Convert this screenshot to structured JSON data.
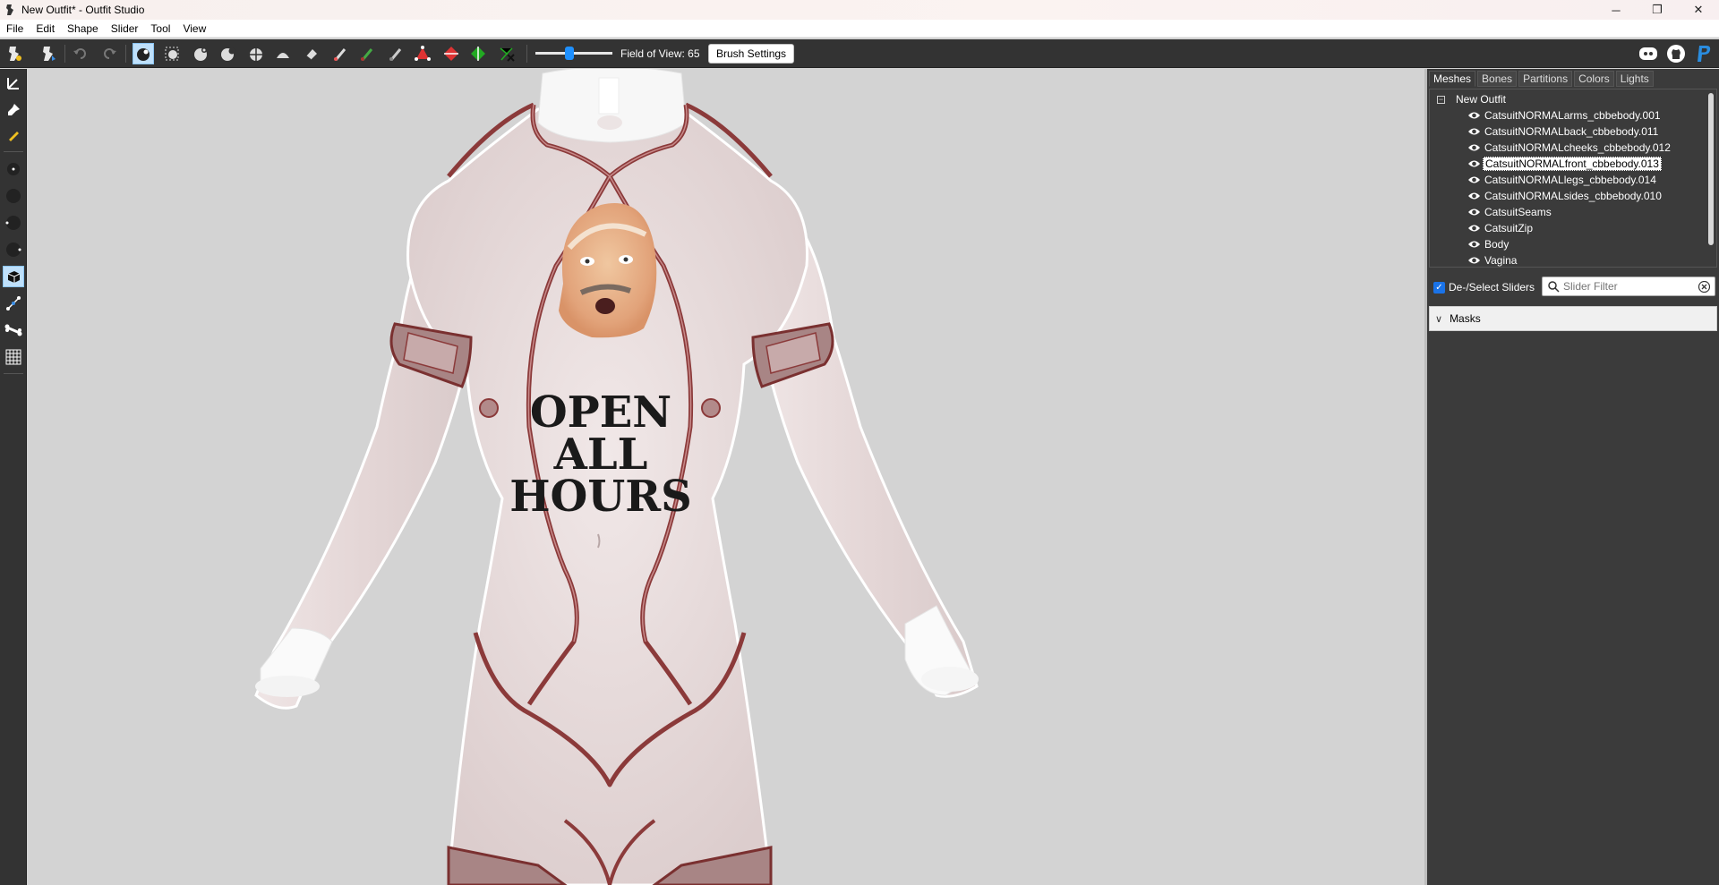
{
  "window": {
    "title": "New Outfit* - Outfit Studio",
    "minimize_glyph": "─",
    "restore_glyph": "❐",
    "close_glyph": "✕"
  },
  "menu": [
    "File",
    "Edit",
    "Shape",
    "Slider",
    "Tool",
    "View"
  ],
  "toolbar": {
    "field_of_view_label": "Field of View: 65",
    "field_of_view_value": 65,
    "brush_settings_label": "Brush Settings",
    "icons": [
      "load-project-icon",
      "save-project-icon",
      "undo-icon",
      "redo-icon",
      "select-brush-icon",
      "mask-brush-icon",
      "inflate-brush-icon",
      "deflate-brush-icon",
      "move-brush-icon",
      "smooth-brush-icon",
      "undiff-brush-icon",
      "weight-brush-icon",
      "color-brush-icon",
      "alpha-brush-icon",
      "collapse-vertex-icon",
      "flip-edge-icon",
      "split-edge-icon",
      "delete-vertex-icon"
    ],
    "right_icons": [
      "discord-icon",
      "github-icon",
      "paypal-icon"
    ]
  },
  "left_tools": [
    "transform-tool-icon",
    "pivot-tool-icon",
    "pen-tool-icon",
    "small-brush-icon",
    "medium-brush-icon",
    "large-brush-icon",
    "xl-brush-icon",
    "vertex-select-icon",
    "edge-tool-icon",
    "bone-tool-icon",
    "grid-icon"
  ],
  "viewport": {
    "shirt_text_lines": [
      "OPEN",
      "ALL",
      "HOURS"
    ]
  },
  "right_panel": {
    "tabs": [
      "Meshes",
      "Bones",
      "Partitions",
      "Colors",
      "Lights"
    ],
    "active_tab": "Meshes",
    "tree_root": "New Outfit",
    "tree_collapse_glyph": "−",
    "meshes": [
      "CatsuitNORMALarms_cbbebody.001",
      "CatsuitNORMALback_cbbebody.011",
      "CatsuitNORMALcheeks_cbbebody.012",
      "CatsuitNORMALfront_cbbebody.013",
      "CatsuitNORMALlegs_cbbebody.014",
      "CatsuitNORMALsides_cbbebody.010",
      "CatsuitSeams",
      "CatsuitZip",
      "Body",
      "Vagina"
    ],
    "selected_mesh_index": 3,
    "deselect_sliders_label": "De-/Select Sliders",
    "deselect_checked": true,
    "slider_filter_placeholder": "Slider Filter",
    "masks_label": "Masks"
  },
  "colors": {
    "toolbar_bg": "#333333",
    "panel_bg": "#3b3b3b",
    "viewport_bg": "#d3d3d3",
    "accent": "#1a73e8",
    "suit_body": "#e8dada",
    "trim": "#8b3a3a"
  }
}
